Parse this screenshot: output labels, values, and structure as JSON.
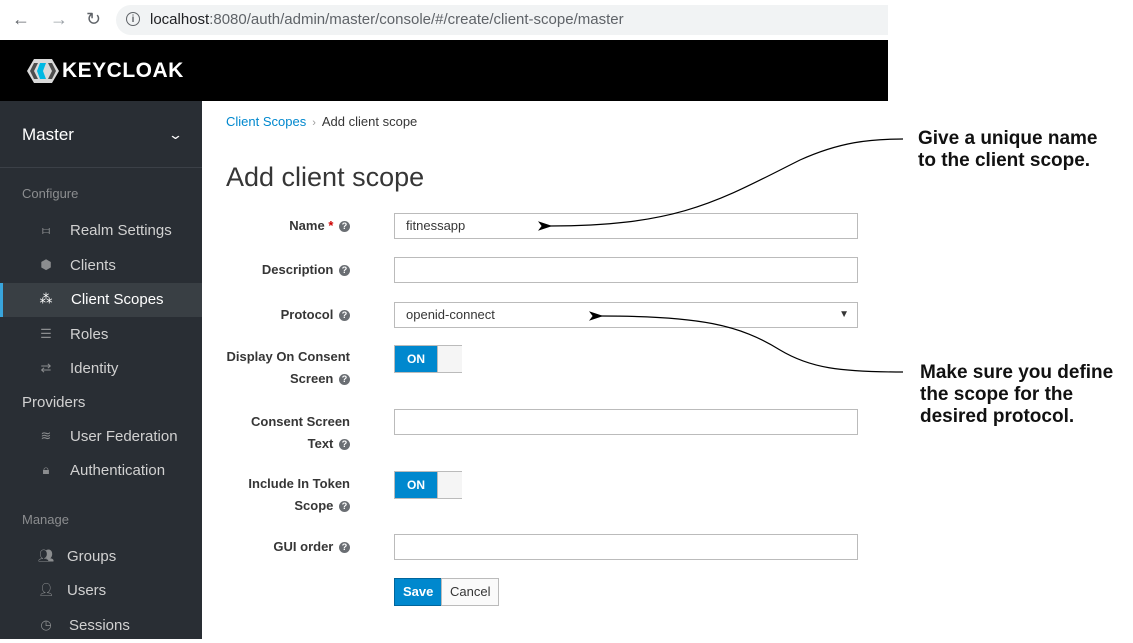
{
  "browser": {
    "url_host": "localhost",
    "url_rest": ":8080/auth/admin/master/console/#/create/client-scope/master"
  },
  "header": {
    "logo_text": "KEYCLOAK"
  },
  "sidebar": {
    "realm": "Master",
    "configure_title": "Configure",
    "configure_items": [
      {
        "label": "Realm Settings",
        "icon": "sliders-icon"
      },
      {
        "label": "Clients",
        "icon": "cube-icon"
      },
      {
        "label": "Client Scopes",
        "icon": "cubes-icon",
        "active": true
      },
      {
        "label": "Roles",
        "icon": "list-icon"
      },
      {
        "label": "Identity",
        "icon": "exchange-icon"
      },
      {
        "label": "Providers"
      },
      {
        "label": "User Federation",
        "icon": "database-icon"
      },
      {
        "label": "Authentication",
        "icon": "lock-icon"
      }
    ],
    "manage_title": "Manage",
    "manage_items": [
      {
        "label": "Groups",
        "icon": "users-icon"
      },
      {
        "label": "Users",
        "icon": "user-icon"
      },
      {
        "label": "Sessions",
        "icon": "clock-icon"
      }
    ]
  },
  "breadcrumb": {
    "parent": "Client Scopes",
    "current": "Add client scope"
  },
  "page_title": "Add client scope",
  "form": {
    "name_label": "Name",
    "name_value": "fitnessapp",
    "description_label": "Description",
    "description_value": "",
    "protocol_label": "Protocol",
    "protocol_value": "openid-connect",
    "display_consent_label_1": "Display On Consent",
    "display_consent_label_2": "Screen",
    "display_consent_value": "ON",
    "consent_text_label_1": "Consent Screen",
    "consent_text_label_2": "Text",
    "consent_text_value": "",
    "include_token_label_1": "Include In Token",
    "include_token_label_2": "Scope",
    "include_token_value": "ON",
    "gui_order_label": "GUI order",
    "gui_order_value": "",
    "save_label": "Save",
    "cancel_label": "Cancel"
  },
  "annotations": {
    "name_note_1": "Give a unique name",
    "name_note_2": "to the client scope.",
    "protocol_note_1": "Make sure you define",
    "protocol_note_2": "the scope for the",
    "protocol_note_3": "desired protocol."
  },
  "colors": {
    "accent": "#0088ce",
    "sidebar_bg": "#292e34",
    "header_bg": "#000000"
  }
}
